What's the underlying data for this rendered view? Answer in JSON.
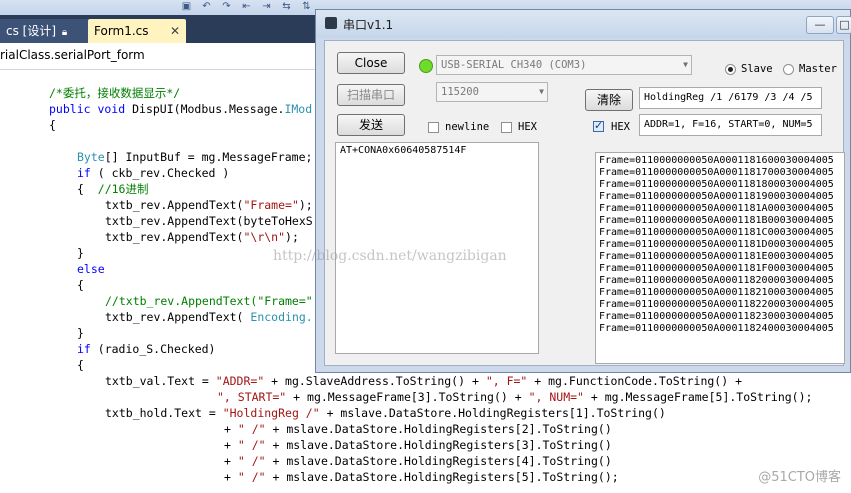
{
  "ide": {
    "tab_inactive": "cs [设计]",
    "tab_active": "Form1.cs",
    "nav_path": "rialClass.serialPort_form",
    "code_lines": [
      {
        "cls": "cm",
        "text": "/*委托，接收数据显示*/"
      },
      {
        "cls": "kw",
        "text": "public void"
      },
      {
        "cls": "tx",
        "text": "DispUI(Modbus.Message."
      },
      {
        "cls": "ty",
        "text": "IMod"
      },
      {
        "cls": "tx",
        "text": "{"
      },
      {
        "cls": "ty",
        "text": "Byte"
      },
      {
        "cls": "tx",
        "text": "[] InputBuf = mg.MessageFrame;"
      },
      {
        "cls": "kw",
        "text": "if"
      },
      {
        "cls": "tx",
        "text": " ( ckb_rev.Checked )"
      },
      {
        "cls": "tx",
        "text": "{  "
      },
      {
        "cls": "cm",
        "text": "//16进制"
      },
      {
        "cls": "tx",
        "text": "txtb_rev.AppendText("
      },
      {
        "cls": "st",
        "text": "\"Frame=\""
      },
      {
        "cls": "tx",
        "text": ");"
      },
      {
        "cls": "tx",
        "text": "txtb_rev.AppendText(byteToHexS"
      },
      {
        "cls": "tx",
        "text": "txtb_rev.AppendText("
      },
      {
        "cls": "st",
        "text": "\"\\r\\n\""
      },
      {
        "cls": "tx",
        "text": ");"
      },
      {
        "cls": "tx",
        "text": "}"
      },
      {
        "cls": "kw",
        "text": "else"
      },
      {
        "cls": "tx",
        "text": "{"
      },
      {
        "cls": "cm",
        "text": "//txtb_rev.AppendText(\"Frame=\""
      },
      {
        "cls": "tx",
        "text": "txtb_rev.AppendText( "
      },
      {
        "cls": "ty",
        "text": "Encoding."
      },
      {
        "cls": "tx",
        "text": "}"
      },
      {
        "cls": "kw",
        "text": "if"
      },
      {
        "cls": "tx",
        "text": " (radio_S.Checked)"
      },
      {
        "cls": "tx",
        "text": "{"
      },
      {
        "cls": "tx",
        "text": "txtb_val.Text = "
      },
      {
        "cls": "st",
        "text": "\"ADDR=\""
      },
      {
        "cls": "tx",
        "text": " + mg.SlaveAddress.ToString() + "
      },
      {
        "cls": "st",
        "text": "\", F=\""
      },
      {
        "cls": "tx",
        "text": " + mg.FunctionCode.ToString() +"
      },
      {
        "cls": "st",
        "text": "\", START=\""
      },
      {
        "cls": "tx",
        "text": " + mg.MessageFrame[3].ToString() + "
      },
      {
        "cls": "st",
        "text": "\", NUM=\""
      },
      {
        "cls": "tx",
        "text": " + mg.MessageFrame[5].ToString();"
      },
      {
        "cls": "tx",
        "text": "txtb_hold.Text = "
      },
      {
        "cls": "st",
        "text": "\"HoldingReg /\""
      },
      {
        "cls": "tx",
        "text": " + mslave.DataStore.HoldingRegisters[1].ToString()"
      },
      {
        "cls": "tx",
        "text": "+ "
      },
      {
        "cls": "st",
        "text": "\" /\""
      },
      {
        "cls": "tx",
        "text": " + mslave.DataStore.HoldingRegisters[2].ToString()"
      },
      {
        "cls": "tx",
        "text": "+ "
      },
      {
        "cls": "st",
        "text": "\" /\""
      },
      {
        "cls": "tx",
        "text": " + mslave.DataStore.HoldingRegisters[3].ToString()"
      },
      {
        "cls": "tx",
        "text": "+ "
      },
      {
        "cls": "st",
        "text": "\" /\""
      },
      {
        "cls": "tx",
        "text": " + mslave.DataStore.HoldingRegisters[4].ToString()"
      },
      {
        "cls": "tx",
        "text": "+ "
      },
      {
        "cls": "st",
        "text": "\" /\""
      },
      {
        "cls": "tx",
        "text": " + mslave.DataStore.HoldingRegisters[5].ToString();"
      }
    ]
  },
  "app": {
    "title": "串口v1.1",
    "minimize_label": "—",
    "maximize_label": "□",
    "close_button": "Close",
    "scan_button": "扫描串口",
    "send_button": "发送",
    "clear_button": "清除",
    "port_value": "USB-SERIAL CH340 (COM3)",
    "baud_value": "115200",
    "newline_label": "newline",
    "hex_send_label": "HEX",
    "hex_recv_label": "HEX",
    "slave_label": "Slave",
    "master_label": "Master",
    "send_text": "AT+CONA0x60640587514F",
    "holding_text": "HoldingReg /1 /6179 /3 /4 /5",
    "val_text": "ADDR=1, F=16, START=0, NUM=5",
    "frames": [
      "Frame=0110000000050A0001181600030004005",
      "Frame=0110000000050A0001181700030004005",
      "Frame=0110000000050A0001181800030004005",
      "Frame=0110000000050A0001181900030004005",
      "Frame=0110000000050A0001181A00030004005",
      "Frame=0110000000050A0001181B00030004005",
      "Frame=0110000000050A0001181C00030004005",
      "Frame=0110000000050A0001181D00030004005",
      "Frame=0110000000050A0001181E00030004005",
      "Frame=0110000000050A0001181F00030004005",
      "Frame=0110000000050A0001182000030004005",
      "Frame=0110000000050A0001182100030004005",
      "Frame=0110000000050A0001182200030004005",
      "Frame=0110000000050A0001182300030004005",
      "Frame=0110000000050A0001182400030004005"
    ]
  },
  "watermark": "http://blog.csdn.net/wangzibigan",
  "corner_mark": "@51CTO博客",
  "colors": {
    "led_green": "#6fdc2a",
    "tab_active_bg": "#fff4bf",
    "window_frame": "#ccd9ea"
  }
}
